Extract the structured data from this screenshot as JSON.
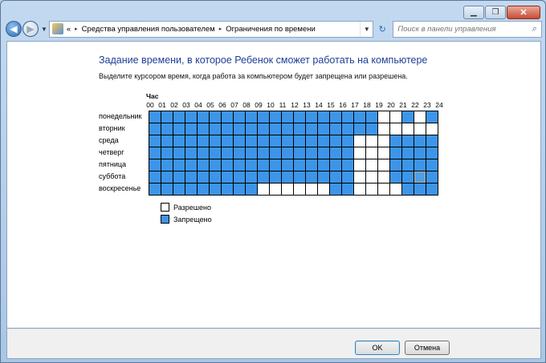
{
  "window": {
    "minimize": "▁",
    "maximize": "❐",
    "close": "✕"
  },
  "nav": {
    "breadcrumb_prefix": "«",
    "crumbs": [
      "Средства управления пользователем",
      "Ограничения по времени"
    ],
    "crumb_separator": "▸",
    "search_placeholder": "Поиск в панели управления"
  },
  "page": {
    "title": "Задание времени, в которое Ребенок сможет работать на компьютере",
    "description": "Выделите курсором время, когда работа за компьютером будет запрещена или разрешена.",
    "hour_label": "Час",
    "hours": [
      "00",
      "01",
      "02",
      "03",
      "04",
      "05",
      "06",
      "07",
      "08",
      "09",
      "10",
      "11",
      "12",
      "13",
      "14",
      "15",
      "16",
      "17",
      "18",
      "19",
      "20",
      "21",
      "22",
      "23",
      "24"
    ],
    "days": [
      "понедельник",
      "вторник",
      "среда",
      "четверг",
      "пятница",
      "суббота",
      "воскресенье"
    ]
  },
  "schedule": {
    "legend_meaning": {
      "0": "allowed",
      "1": "blocked"
    },
    "rows": [
      "111111111111111111100101",
      "111111111111111111100000",
      "111111111111111110001111",
      "111111111111111110001111",
      "111111111111111110001111",
      "111111111111111110001111",
      "111111111000000110000111"
    ]
  },
  "legend": {
    "allowed": "Разрешено",
    "blocked": "Запрещено"
  },
  "footer": {
    "ok": "OK",
    "cancel": "Отмена"
  },
  "colors": {
    "blocked": "#3d95e8",
    "allowed": "#ffffff",
    "title": "#1e3f96"
  }
}
